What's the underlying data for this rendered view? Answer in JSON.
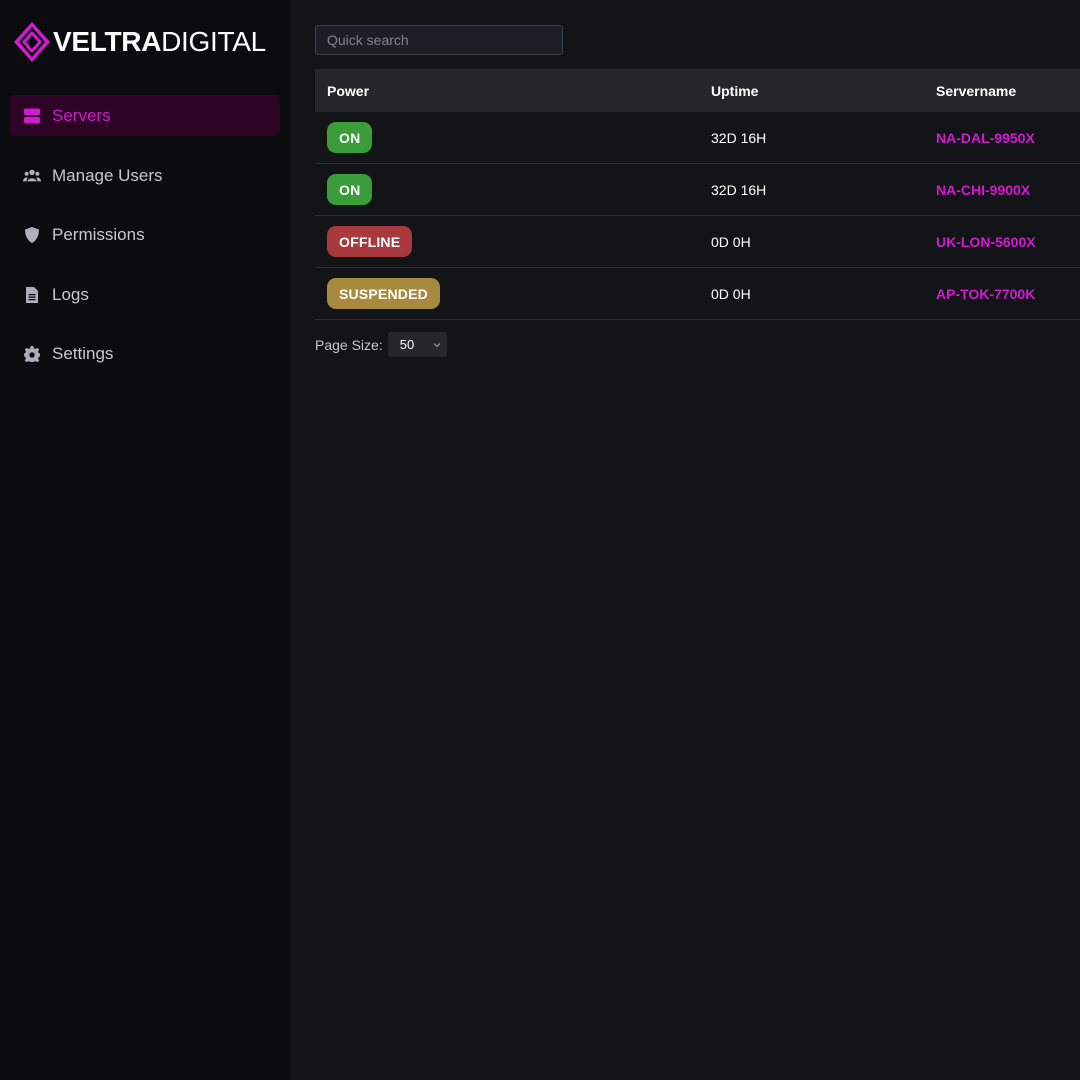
{
  "brand": {
    "name_bold": "VELTRA",
    "name_light": "DIGITAL",
    "accent_color": "#d21ad1",
    "logo_icon": "veltra-logo-icon"
  },
  "sidebar": {
    "items": [
      {
        "label": "Servers",
        "icon": "servers-icon",
        "active": true
      },
      {
        "label": "Manage Users",
        "icon": "users-icon",
        "active": false
      },
      {
        "label": "Permissions",
        "icon": "shield-icon",
        "active": false
      },
      {
        "label": "Logs",
        "icon": "document-icon",
        "active": false
      },
      {
        "label": "Settings",
        "icon": "gear-icon",
        "active": false
      }
    ]
  },
  "search": {
    "placeholder": "Quick search",
    "value": ""
  },
  "table": {
    "columns": [
      "Power",
      "Uptime",
      "Servername"
    ],
    "rows": [
      {
        "power": "ON",
        "power_color": "#3b9d3a",
        "uptime": "32D 16H",
        "servername": "NA-DAL-9950X"
      },
      {
        "power": "ON",
        "power_color": "#3b9d3a",
        "uptime": "32D 16H",
        "servername": "NA-CHI-9900X"
      },
      {
        "power": "OFFLINE",
        "power_color": "#a8393c",
        "uptime": "0D 0H",
        "servername": "UK-LON-5600X"
      },
      {
        "power": "SUSPENDED",
        "power_color": "#a88a3e",
        "uptime": "0D 0H",
        "servername": "AP-TOK-7700K"
      }
    ]
  },
  "pager": {
    "label": "Page Size:",
    "value": "50",
    "icon": "chevron-down-icon"
  }
}
